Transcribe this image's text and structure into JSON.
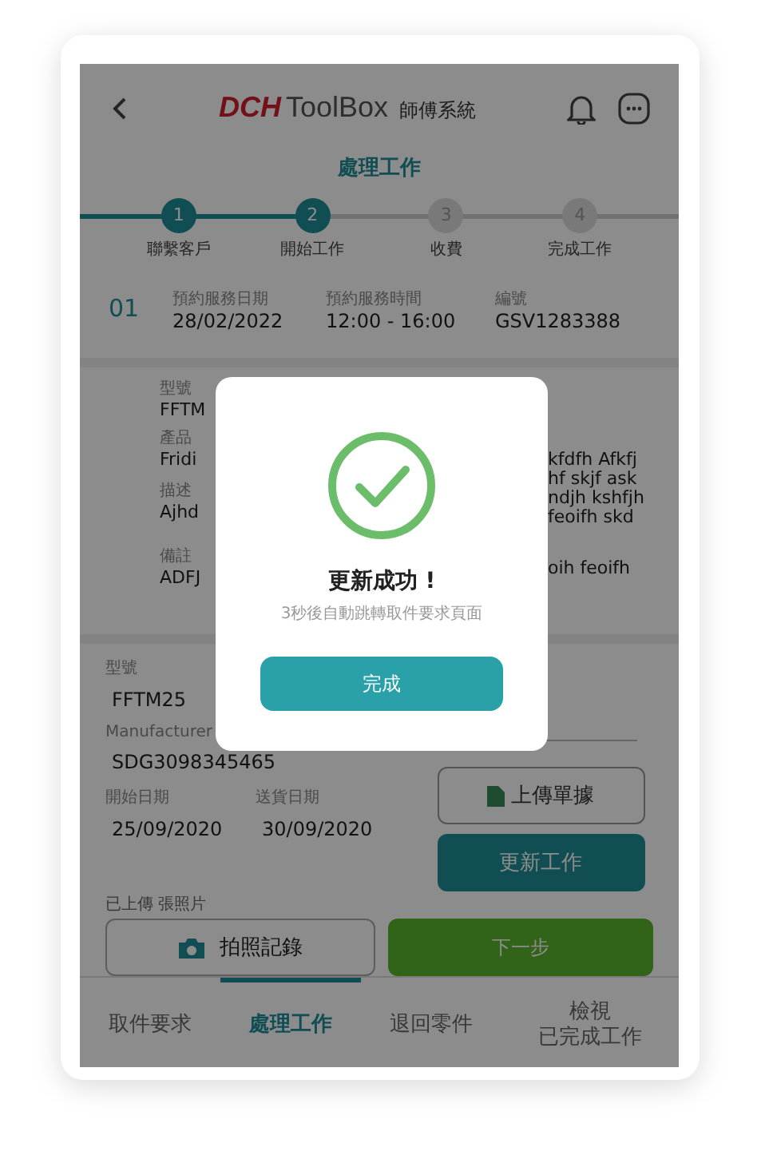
{
  "header": {
    "logo_brand": "DCH",
    "logo_product": "ToolBox",
    "app_name": "師傅系統"
  },
  "page_title": "處理工作",
  "steps": [
    {
      "number": "1",
      "label": "聯繫客戶",
      "done": true
    },
    {
      "number": "2",
      "label": "開始工作",
      "done": true
    },
    {
      "number": "3",
      "label": "收費",
      "done": false
    },
    {
      "number": "4",
      "label": "完成工作",
      "done": false
    }
  ],
  "job": {
    "index": "01",
    "fields": [
      {
        "label": "預約服務日期",
        "value": "28/02/2022"
      },
      {
        "label": "預約服務時間",
        "value": "12:00 - 16:00"
      },
      {
        "label": "編號",
        "value": "GSV1283388"
      }
    ]
  },
  "details": {
    "left": [
      {
        "label": "型號",
        "value": "FFTM"
      },
      {
        "label": "產品",
        "value": "Fridi"
      },
      {
        "label": "描述",
        "value": "Ajhd"
      },
      {
        "label": "備註",
        "value": "ADFJ"
      }
    ],
    "right": [
      "kfdfh Afkfj",
      "hf skjf ask",
      "ndjh kshfjh",
      "feoifh skd",
      "oih feoifh"
    ]
  },
  "form": {
    "model_label": "型號",
    "model_value": "FFTM25",
    "serial_label": "Manufacturer",
    "serial_value": "SDG3098345465",
    "start_label": "開始日期",
    "start_value": "25/09/2020",
    "end_label": "送貨日期",
    "end_value": "30/09/2020"
  },
  "upload_button": "上傳單據",
  "update_button": "更新工作",
  "photo_note": "已上傳 張照片",
  "photo_button": "拍照記錄",
  "next_button": "下一步",
  "tabs": [
    {
      "label": "取件要求",
      "selected": false
    },
    {
      "label": "處理工作",
      "selected": true
    },
    {
      "label": "退回零件",
      "selected": false
    },
    {
      "lines": [
        "檢視",
        "已完成工作"
      ],
      "selected": false
    }
  ],
  "modal": {
    "title": "更新成功 !",
    "message": "3秒後自動跳轉取件要求頁面",
    "button": "完成"
  }
}
